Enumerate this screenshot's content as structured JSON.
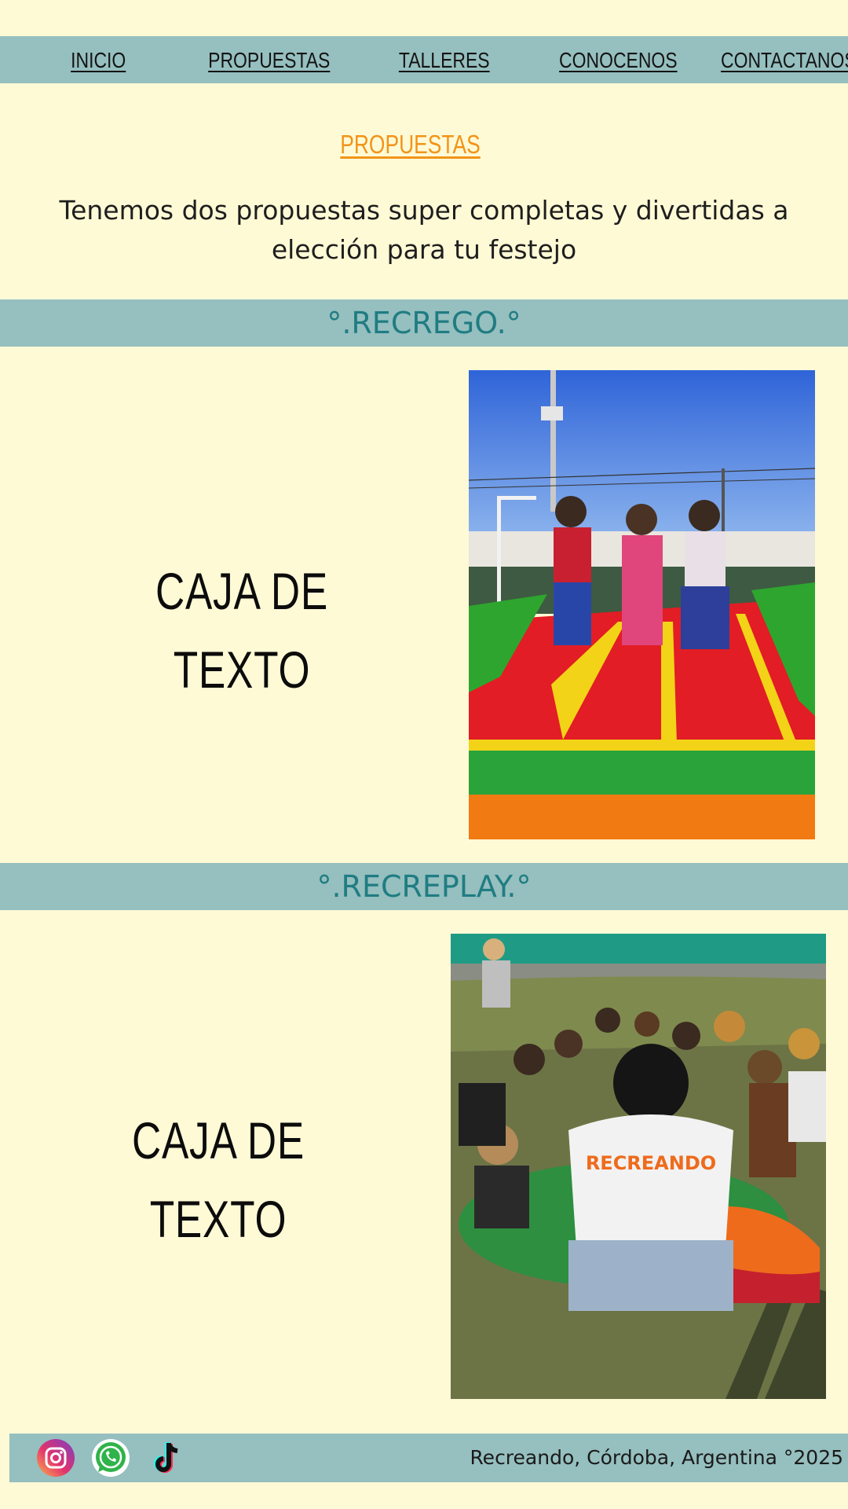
{
  "nav": {
    "items": [
      {
        "label": "INICIO"
      },
      {
        "label": "PROPUESTAS"
      },
      {
        "label": "TALLERES"
      },
      {
        "label": "CONOCENOS"
      },
      {
        "label": "CONTACTANOS"
      }
    ]
  },
  "intro": {
    "section_link": "PROPUESTAS",
    "text_line1": "Tenemos dos propuestas super completas y divertidas a",
    "text_line2": "elección  para tu festejo"
  },
  "sections": [
    {
      "title": "°.RECREGO.°",
      "caja_line1": "CAJA DE",
      "caja_line2": "TEXTO"
    },
    {
      "title": "°.RECREPLAY.°",
      "caja_line1": "CAJA DE",
      "caja_line2": "TEXTO",
      "shirt_logo": "RECREANDO"
    }
  ],
  "footer": {
    "icons": [
      "instagram-icon",
      "whatsapp-icon",
      "tiktok-icon"
    ],
    "text": "Recreando, Córdoba, Argentina °2025"
  },
  "colors": {
    "background": "#fffad6",
    "band": "#96bfbf",
    "band_text": "#1f7d82",
    "accent_orange": "#f29418"
  }
}
